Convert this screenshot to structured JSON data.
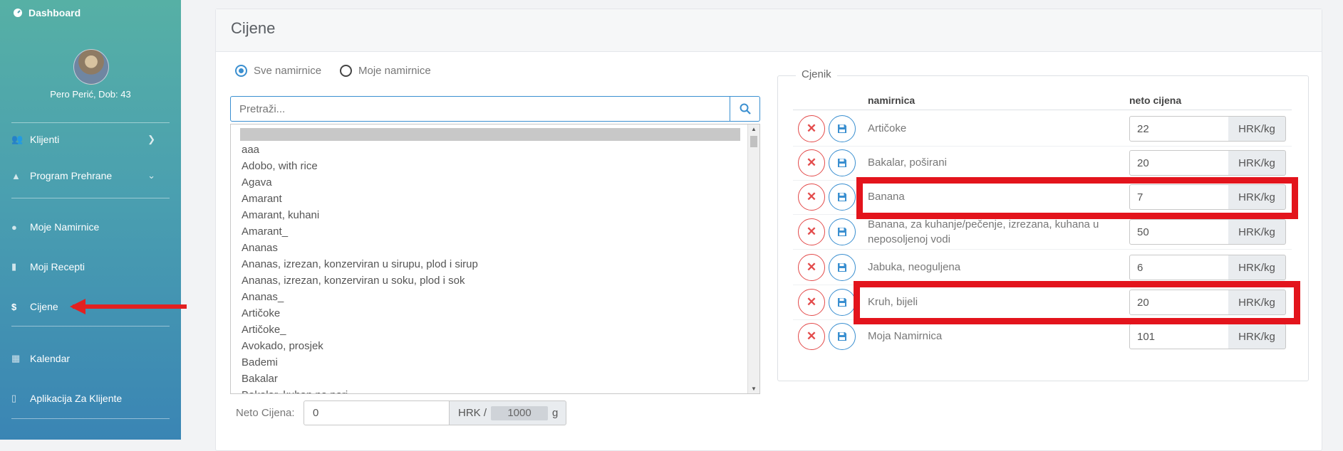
{
  "sidebar": {
    "dashboard": "Dashboard",
    "user": "Pero Perić, Dob: 43",
    "items": [
      {
        "label": "Klijenti"
      },
      {
        "label": "Program Prehrane"
      },
      {
        "label": "Moje Namirnice"
      },
      {
        "label": "Moji Recepti"
      },
      {
        "label": "Cijene"
      },
      {
        "label": "Kalendar"
      },
      {
        "label": "Aplikacija Za Klijente"
      }
    ]
  },
  "page": {
    "title": "Cijene"
  },
  "filter": {
    "all": "Sve namirnice",
    "mine": "Moje namirnice",
    "selected": "Sve namirnice"
  },
  "search": {
    "placeholder": "Pretraži..."
  },
  "food_list": [
    "aaa",
    "Adobo, with rice",
    "Agava",
    "Amarant",
    "Amarant, kuhani",
    "Amarant_",
    "Ananas",
    "Ananas, izrezan, konzerviran u sirupu, plod i sirup",
    "Ananas, izrezan, konzerviran u soku, plod i sok",
    "Ananas_",
    "Artičoke",
    "Artičoke_",
    "Avokado, prosjek",
    "Bademi",
    "Bakalar",
    "Bakalar, kuhan na pari"
  ],
  "neto": {
    "label": "Neto Cijena:",
    "value": "0",
    "unit_prefix": "HRK /",
    "grams": "1000",
    "unit_suffix": "g"
  },
  "cjenik": {
    "legend": "Cjenik",
    "col_name": "namirnica",
    "col_price": "neto cijena",
    "rows": [
      {
        "name": "Artičoke",
        "price": "22",
        "unit": "HRK/kg"
      },
      {
        "name": "Bakalar, poširani",
        "price": "20",
        "unit": "HRK/kg"
      },
      {
        "name": "Banana",
        "price": "7",
        "unit": "HRK/kg"
      },
      {
        "name": "Banana, za kuhanje/pečenje, izrezana, kuhana u neposoljenoj vodi",
        "price": "50",
        "unit": "HRK/kg"
      },
      {
        "name": "Jabuka, neoguljena",
        "price": "6",
        "unit": "HRK/kg"
      },
      {
        "name": "Kruh, bijeli",
        "price": "20",
        "unit": "HRK/kg"
      },
      {
        "name": "Moja Namirnica",
        "price": "101",
        "unit": "HRK/kg"
      }
    ]
  },
  "colors": {
    "accent": "#3a8fd0",
    "danger": "#e34b4b",
    "highlight": "#e3141c"
  }
}
